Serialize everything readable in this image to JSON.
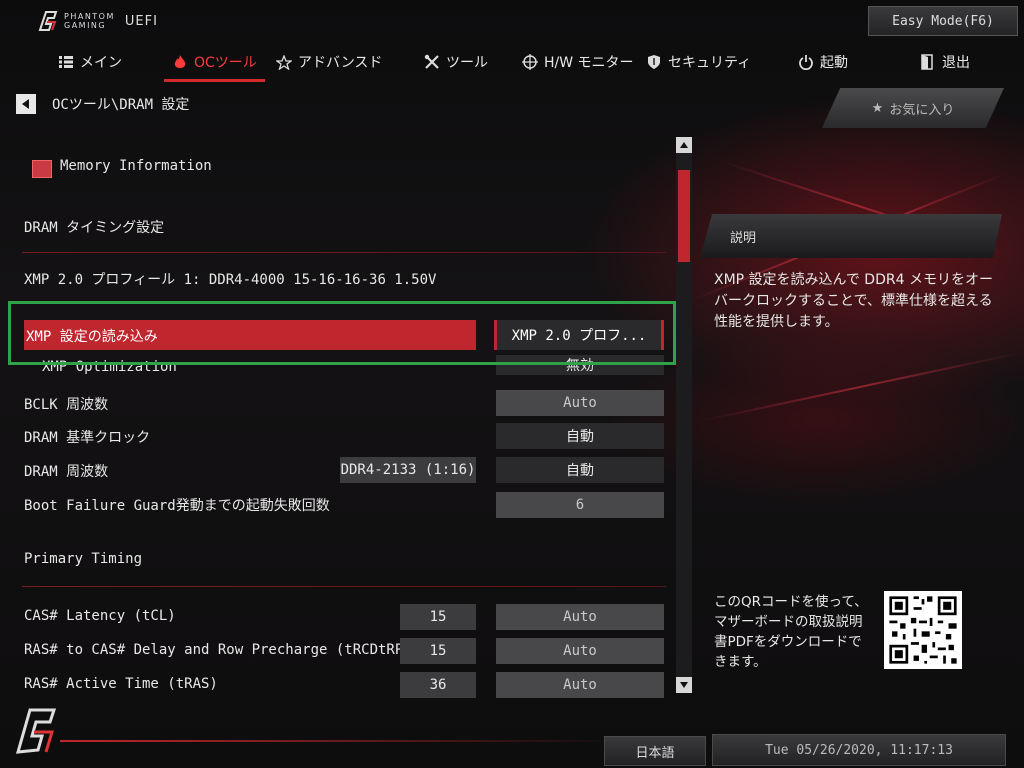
{
  "header": {
    "brand_line1": "PHANTOM",
    "brand_line2": "GAMING",
    "product": "UEFI",
    "easy_mode_label": "Easy Mode(F6)"
  },
  "nav": {
    "tabs": [
      {
        "label": "メイン",
        "icon": "list-icon"
      },
      {
        "label": "OCツール",
        "icon": "flame-icon",
        "active": true
      },
      {
        "label": "アドバンスド",
        "icon": "star-icon"
      },
      {
        "label": "ツール",
        "icon": "tools-icon"
      },
      {
        "label": "H/W モニター",
        "icon": "crosshair-icon"
      },
      {
        "label": "セキュリティ",
        "icon": "shield-icon"
      },
      {
        "label": "起動",
        "icon": "power-icon"
      },
      {
        "label": "退出",
        "icon": "exit-door-icon"
      }
    ]
  },
  "breadcrumb": {
    "path": "OCツール\\DRAM 設定"
  },
  "favorites": {
    "label": "お気に入り"
  },
  "main": {
    "memory_info": "Memory Information",
    "dram_timing_header": "DRAM タイミング設定",
    "xmp_profile_line": "XMP 2.0 プロフィール 1: DDR4-4000 15-16-16-36 1.50V",
    "load_xmp": {
      "label": "XMP 設定の読み込み",
      "value": "XMP 2.0 プロフ..."
    },
    "xmp_optimization": {
      "label": "XMP Optimization",
      "value": "無効"
    },
    "bclk": {
      "label": "BCLK 周波数",
      "value": "Auto"
    },
    "dram_ref_clock": {
      "label": "DRAM 基準クロック",
      "value": "自動"
    },
    "dram_freq": {
      "label": "DRAM 周波数",
      "info": "DDR4-2133 (1:16)",
      "value": "自動"
    },
    "boot_failure_guard": {
      "label": "Boot Failure Guard発動までの起動失敗回数",
      "value": "6"
    },
    "primary_timing_header": "Primary Timing",
    "timings": [
      {
        "label": "CAS# Latency (tCL)",
        "current": "15",
        "value": "Auto"
      },
      {
        "label": "RAS# to CAS# Delay and Row Precharge (tRCDtRP)",
        "current": "15",
        "value": "Auto"
      },
      {
        "label": "RAS# Active Time (tRAS)",
        "current": "36",
        "value": "Auto"
      }
    ]
  },
  "description": {
    "header": "説明",
    "text": "XMP 設定を読み込んで DDR4 メモリをオーバークロックすることで、標準仕様を超える性能を提供します。"
  },
  "qr": {
    "text": "このQRコードを使って、マザーボードの取扱説明書PDFをダウンロードできます。"
  },
  "footer": {
    "language": "日本語",
    "datetime": "Tue 05/26/2020, 11:17:13"
  },
  "colors": {
    "accent": "#c0262e",
    "highlight_frame": "#2fa34a"
  }
}
